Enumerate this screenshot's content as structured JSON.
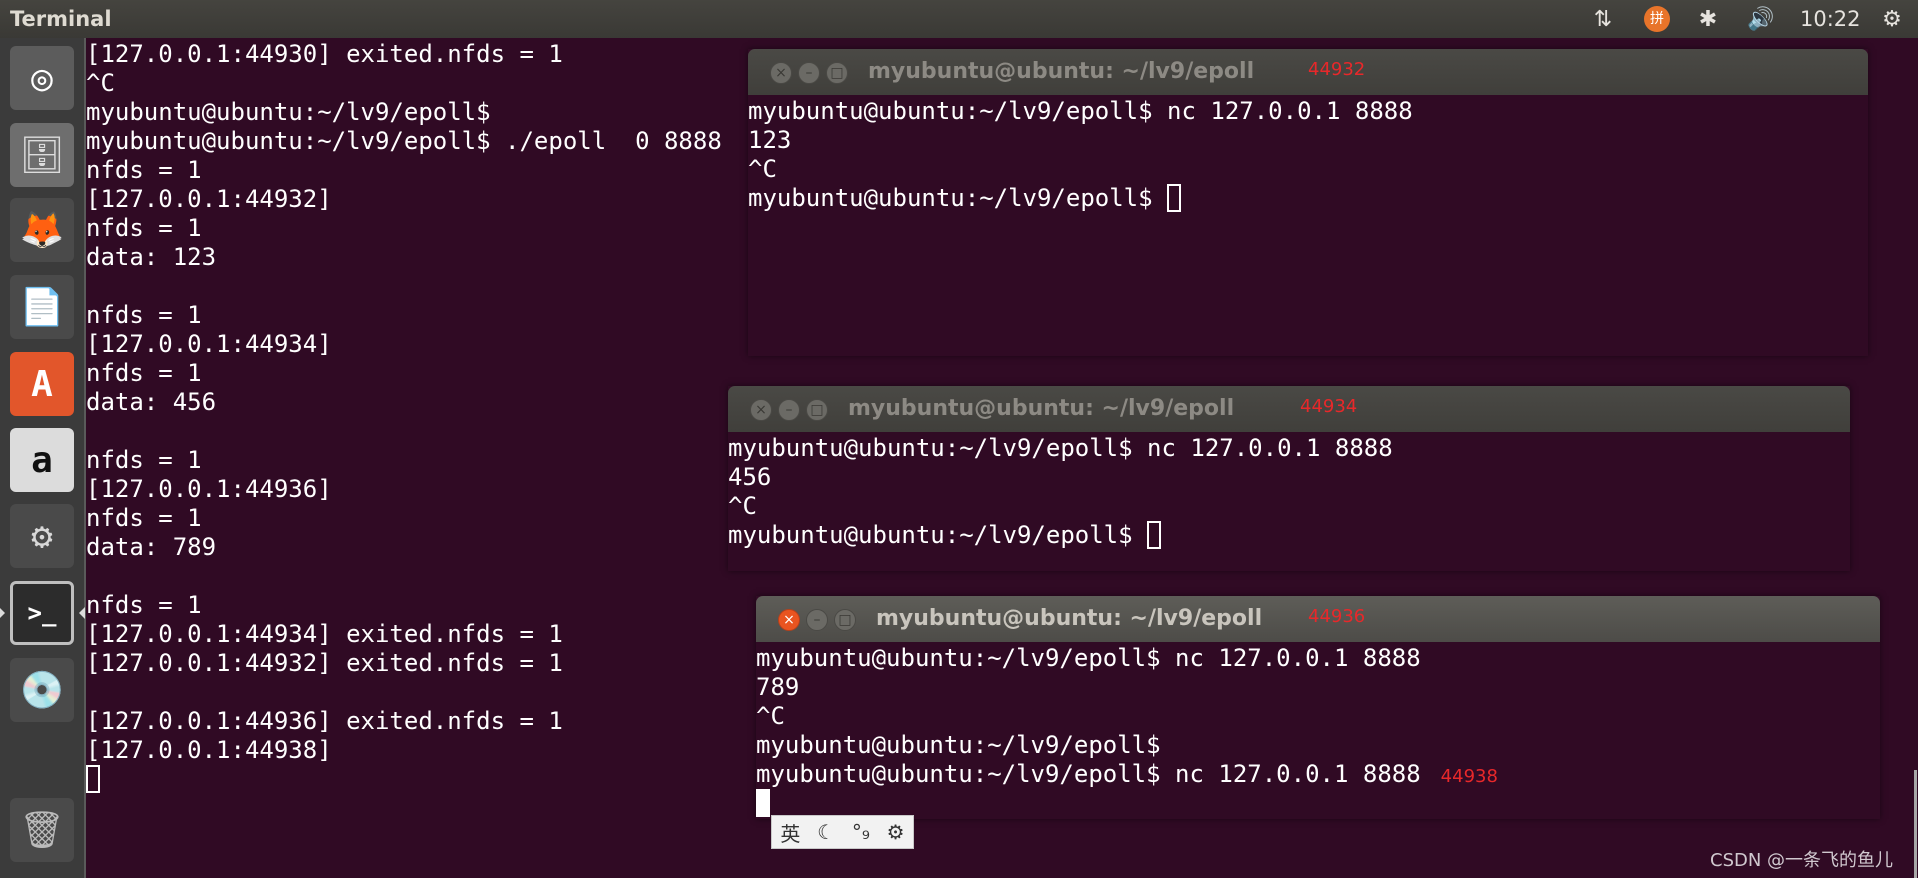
{
  "app_title": "Terminal",
  "clock": "10:22",
  "tray_icons": [
    "network-updown-icon",
    "input-method-icon",
    "bluetooth-icon",
    "volume-icon",
    "settings-gear-icon"
  ],
  "launcher": [
    {
      "name": "ubuntu-dash-icon",
      "glyph": "◎",
      "bg": "#5c5c5c",
      "color": "#ffffff"
    },
    {
      "name": "files-icon",
      "glyph": "🗄",
      "bg": "#6e6e6e",
      "color": "#dddddd"
    },
    {
      "name": "firefox-icon",
      "glyph": "🦊",
      "bg": "#4a4a4a",
      "color": "#ff7a1a"
    },
    {
      "name": "writer-icon",
      "glyph": "📄",
      "bg": "#4a4a4a",
      "color": "#2a7ab8"
    },
    {
      "name": "software-center-icon",
      "glyph": "A",
      "bg": "#e2562b",
      "color": "#ffffff"
    },
    {
      "name": "amazon-icon",
      "glyph": "a",
      "bg": "#dcdcdc",
      "color": "#111111"
    },
    {
      "name": "system-settings-icon",
      "glyph": "⚙",
      "bg": "#4a4a4a",
      "color": "#d8d8d8"
    },
    {
      "name": "terminal-icon",
      "glyph": ">_",
      "bg": "#2c2c2c",
      "color": "#ffffff"
    },
    {
      "name": "dvd-icon",
      "glyph": "💿",
      "bg": "#4a4a4a",
      "color": "#cccccc"
    },
    {
      "name": "trash-icon",
      "glyph": "🗑",
      "bg": "#4a4a4a",
      "color": "#bbbbbb"
    }
  ],
  "main_terminal": {
    "lines": [
      "[127.0.0.1:44930] exited.nfds = 1",
      "^C",
      "myubuntu@ubuntu:~/lv9/epoll$",
      "myubuntu@ubuntu:~/lv9/epoll$ ./epoll  0 8888",
      "nfds = 1",
      "[127.0.0.1:44932]",
      "nfds = 1",
      "data: 123",
      "",
      "nfds = 1",
      "[127.0.0.1:44934]",
      "nfds = 1",
      "data: 456",
      "",
      "nfds = 1",
      "[127.0.0.1:44936]",
      "nfds = 1",
      "data: 789",
      "",
      "nfds = 1",
      "[127.0.0.1:44934] exited.nfds = 1",
      "[127.0.0.1:44932] exited.nfds = 1",
      "",
      "[127.0.0.1:44936] exited.nfds = 1",
      "[127.0.0.1:44938]"
    ]
  },
  "windows": [
    {
      "title": "myubuntu@ubuntu: ~/lv9/epoll",
      "annotation": "44932",
      "active": false,
      "lines": [
        "myubuntu@ubuntu:~/lv9/epoll$ nc 127.0.0.1 8888",
        "123",
        "^C",
        "myubuntu@ubuntu:~/lv9/epoll$ "
      ]
    },
    {
      "title": "myubuntu@ubuntu: ~/lv9/epoll",
      "annotation": "44934",
      "active": false,
      "lines": [
        "myubuntu@ubuntu:~/lv9/epoll$ nc 127.0.0.1 8888",
        "456",
        "^C",
        "myubuntu@ubuntu:~/lv9/epoll$ "
      ]
    },
    {
      "title": "myubuntu@ubuntu: ~/lv9/epoll",
      "annotation": "44936",
      "active": true,
      "lines": [
        "myubuntu@ubuntu:~/lv9/epoll$ nc 127.0.0.1 8888",
        "789",
        "^C",
        "myubuntu@ubuntu:~/lv9/epoll$",
        "myubuntu@ubuntu:~/lv9/epoll$ nc 127.0.0.1 8888"
      ],
      "extra_annotation": "44938"
    }
  ],
  "ime_bar": {
    "lang": "英",
    "mode": "☾",
    "punct": "°₉",
    "settings": "⚙"
  },
  "watermark": "CSDN @一条飞的鱼儿",
  "colors": {
    "terminal_bg": "#300a24",
    "annotation": "#e8282a",
    "close_button": "#e95420"
  }
}
